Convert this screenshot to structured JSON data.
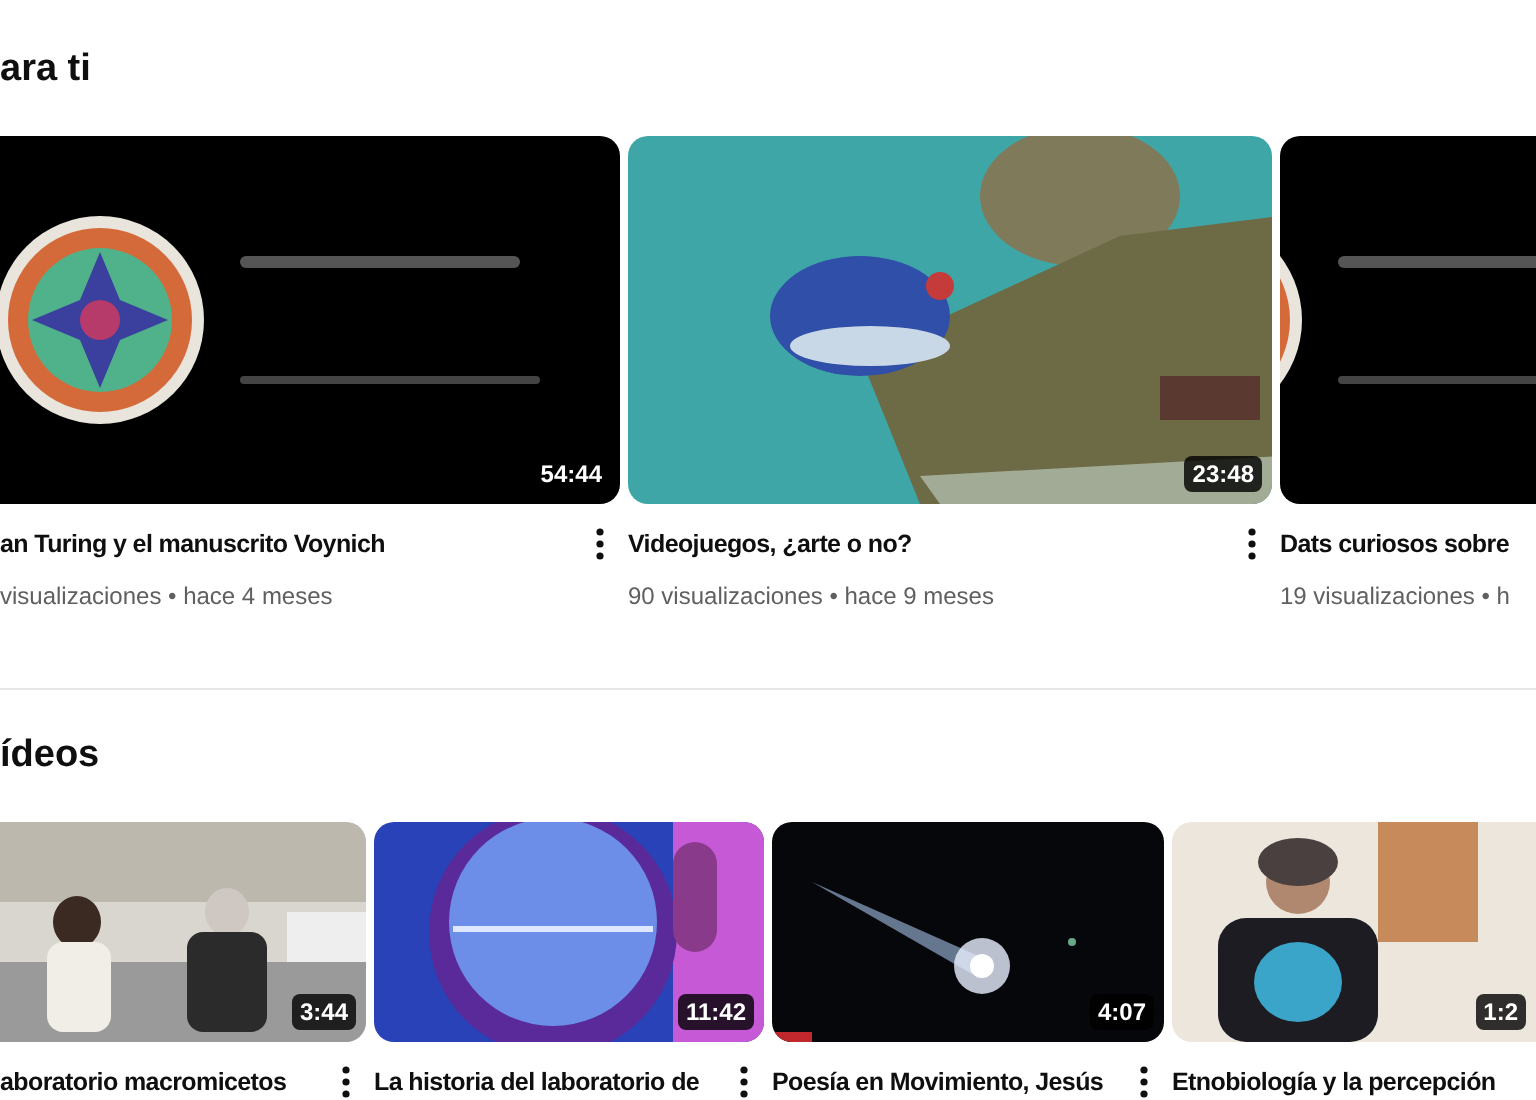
{
  "sections": [
    {
      "title": "ara ti",
      "videos": [
        {
          "kind": "logo",
          "title": "an Turing y el manuscrito Voynich",
          "meta": "visualizaciones • hace 4 meses",
          "duration": "54:44",
          "menu": true
        },
        {
          "kind": "island",
          "title": "Videojuegos, ¿arte o no?",
          "meta": "90 visualizaciones • hace 9 meses",
          "duration": "23:48",
          "menu": true
        },
        {
          "kind": "logo",
          "title": "Dats curiosos sobre",
          "meta": "19 visualizaciones • h",
          "menu": false
        }
      ]
    },
    {
      "title": "ídeos",
      "videos": [
        {
          "kind": "room",
          "title": "aboratorio macromicetos",
          "duration": "3:44",
          "menu": true
        },
        {
          "kind": "banner",
          "title": "La historia del laboratorio de",
          "duration": "11:42",
          "menu": true
        },
        {
          "kind": "stage",
          "title": "Poesía en Movimiento, Jesús",
          "duration": "4:07",
          "menu": true
        },
        {
          "kind": "portrait",
          "title": "Etnobiología y la percepción",
          "duration": "1:2",
          "menu": false
        }
      ]
    }
  ]
}
